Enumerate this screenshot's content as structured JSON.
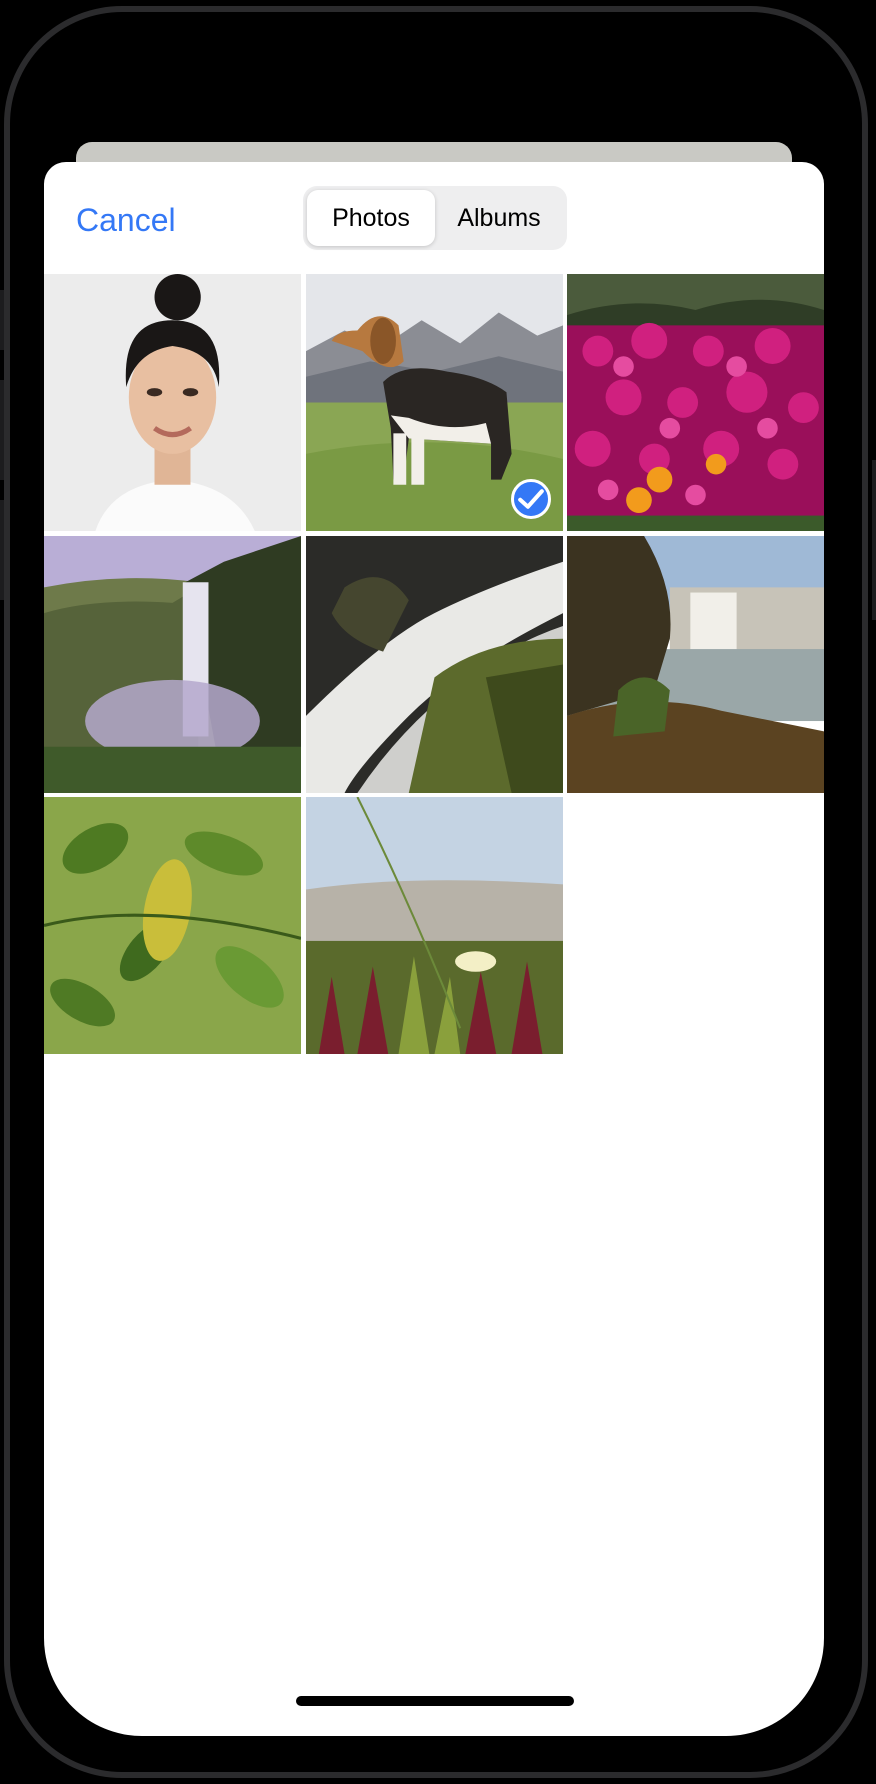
{
  "picker": {
    "cancel_label": "Cancel",
    "segments": [
      {
        "label": "Photos",
        "selected": true
      },
      {
        "label": "Albums",
        "selected": false
      }
    ]
  },
  "photos": [
    {
      "subject": "portrait-woman",
      "selected": false
    },
    {
      "subject": "beagle-dog",
      "selected": true
    },
    {
      "subject": "pink-flowers",
      "selected": false
    },
    {
      "subject": "waterfall-valley",
      "selected": false
    },
    {
      "subject": "waterfall-rocks",
      "selected": false
    },
    {
      "subject": "waterfall-lake",
      "selected": false
    },
    {
      "subject": "green-leaves",
      "selected": false
    },
    {
      "subject": "ice-plant-flower",
      "selected": false
    }
  ],
  "colors": {
    "accent": "#3478f6",
    "sheet": "#ffffff",
    "segment_bg": "#eeeeef"
  }
}
